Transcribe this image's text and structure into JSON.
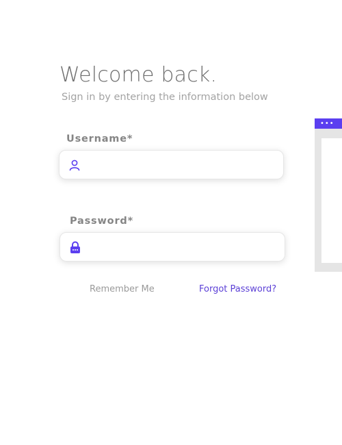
{
  "header": {
    "title": "Welcome back.",
    "subtitle": "Sign in by entering the information below"
  },
  "form": {
    "username": {
      "label": "Username*",
      "value": "",
      "icon": "user-icon"
    },
    "password": {
      "label": "Password*",
      "value": "",
      "icon": "lock-icon"
    },
    "remember_label": "Remember Me",
    "forgot_label": "Forgot Password?"
  },
  "side_window": {
    "controls": "•••"
  },
  "colors": {
    "accent": "#5b3ff0",
    "title": "#6e6e6e",
    "muted": "#a3a3a3"
  }
}
